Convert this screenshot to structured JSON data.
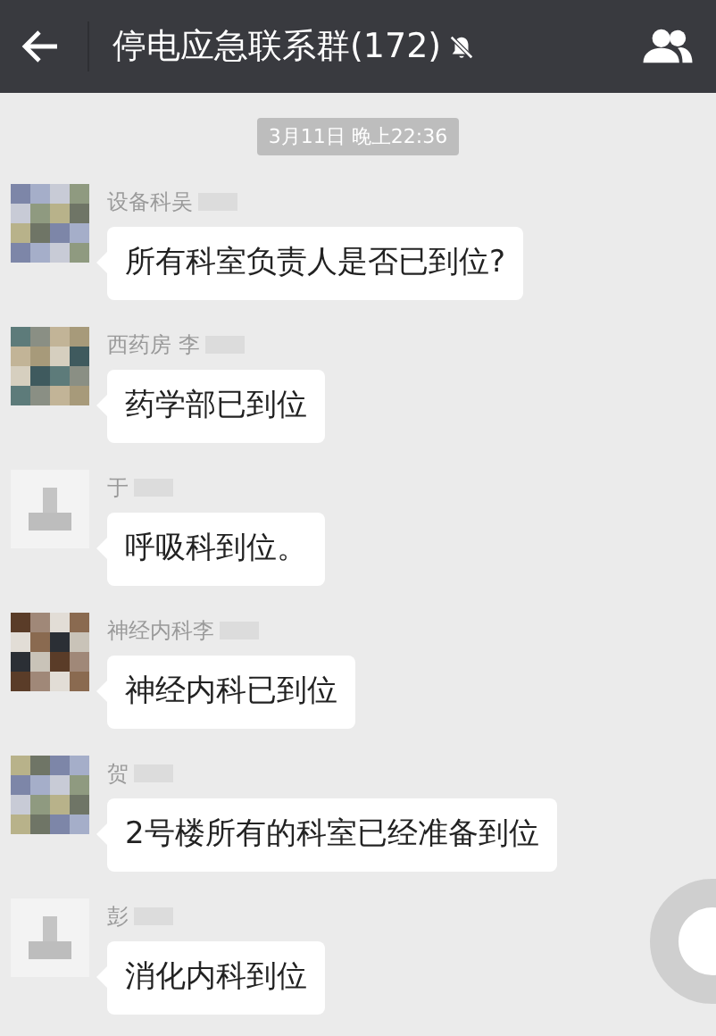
{
  "header": {
    "title": "停电应急联系群(172)",
    "muted": true
  },
  "timestamp": "3月11日 晚上22:36",
  "messages": [
    {
      "sender": "设备科吴",
      "redacted": true,
      "text": "所有科室负责人是否已到位?"
    },
    {
      "sender": "西药房 李",
      "redacted": true,
      "text": "药学部已到位"
    },
    {
      "sender": "于",
      "redacted": true,
      "avatar": {
        "kind": "default"
      },
      "text": "呼吸科到位。"
    },
    {
      "sender": "神经内科李",
      "redacted": true,
      "text": "神经内科已到位"
    },
    {
      "sender": "贺",
      "redacted": true,
      "text": "2号楼所有的科室已经准备到位"
    },
    {
      "sender": "彭",
      "redacted": true,
      "avatar": {
        "kind": "default"
      },
      "text": "消化内科到位"
    }
  ]
}
